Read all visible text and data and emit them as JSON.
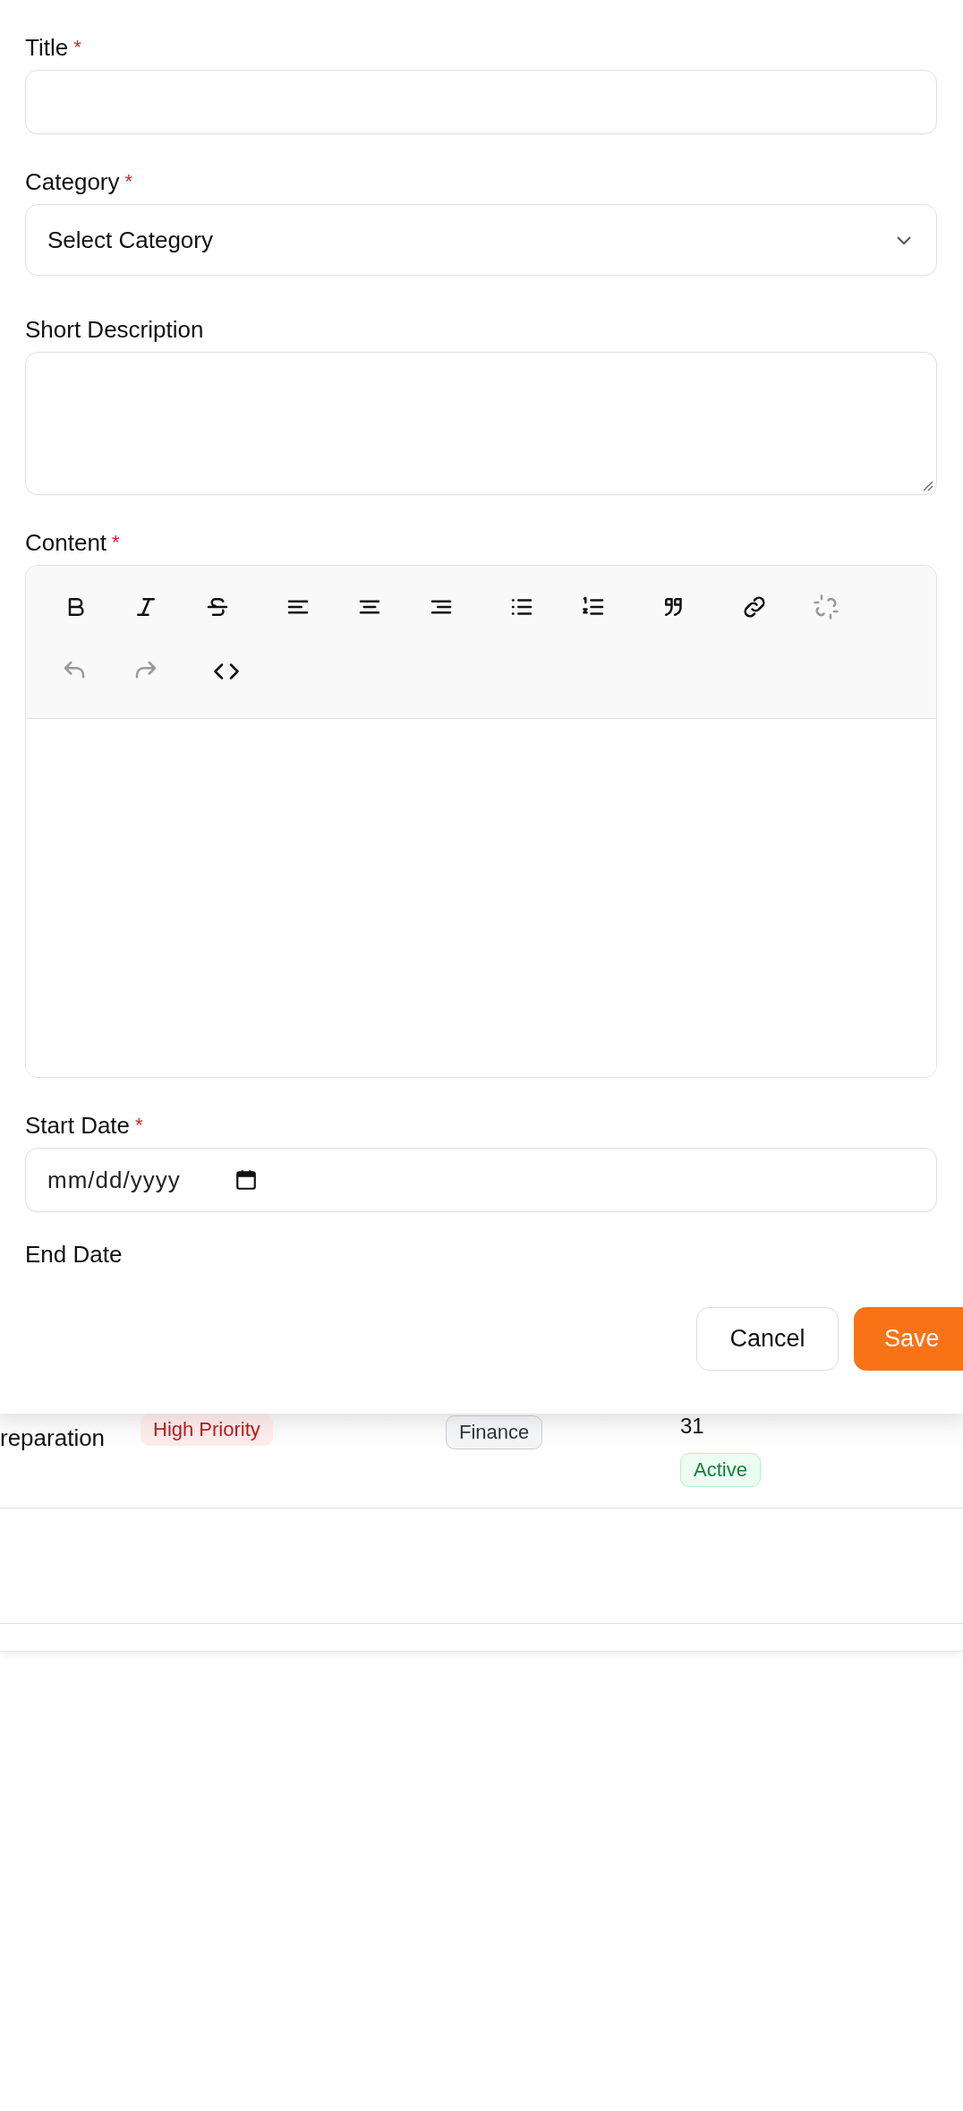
{
  "form": {
    "fields": [
      {
        "kind": "text",
        "label": "Title",
        "marker": "*"
      },
      {
        "kind": "select",
        "label": "Category",
        "marker": "*",
        "placeholder": "Select Category"
      },
      {
        "kind": "textarea",
        "label": "Short Description"
      },
      {
        "kind": "editor",
        "label": "Content",
        "marker": "*",
        "toolbar_rows": [
          [
            {
              "kind": "bold",
              "disabled": false
            },
            {
              "kind": "italic",
              "disabled": false
            },
            {
              "kind": "strike",
              "disabled": false
            },
            {
              "kind": "align-left",
              "disabled": false
            },
            {
              "kind": "align-center",
              "disabled": false
            },
            {
              "kind": "align-right",
              "disabled": false
            },
            {
              "kind": "bullet-list",
              "disabled": false
            },
            {
              "kind": "ordered-list",
              "disabled": false
            },
            {
              "kind": "quote",
              "disabled": false
            },
            {
              "kind": "link",
              "disabled": false
            },
            {
              "kind": "unlink",
              "disabled": true
            }
          ],
          [
            {
              "kind": "undo",
              "disabled": true
            },
            {
              "kind": "redo",
              "disabled": true
            },
            {
              "kind": "code",
              "disabled": false
            }
          ]
        ]
      },
      {
        "kind": "date",
        "label": "Start Date",
        "marker": "*",
        "placeholder": "mm/dd/yyyy"
      },
      {
        "kind": "cut",
        "label": "End Date"
      }
    ]
  },
  "footer": {
    "buttons": [
      {
        "label": "Cancel",
        "kind": "secondary"
      },
      {
        "label": "Save",
        "kind": "primary"
      }
    ]
  },
  "table": {
    "rows": [
      {
        "title": "reparation",
        "priority": "High Priority",
        "category": "Finance",
        "date": "31",
        "status": "Active"
      },
      {}
    ]
  }
}
